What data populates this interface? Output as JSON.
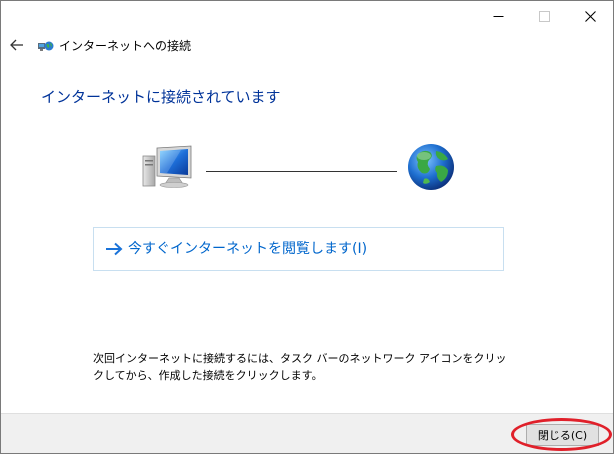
{
  "window": {
    "title": "インターネットへの接続",
    "controls": {
      "minimize": "minimize-icon",
      "maximize": "maximize-icon",
      "close": "close-icon"
    }
  },
  "main": {
    "heading": "インターネットに接続されています",
    "command_link": "今すぐインターネットを閲覧します(I)",
    "help_lines": [
      "次回インターネットに接続するには、タスク バーのネットワーク アイコンをクリッ",
      "クしてから、作成した接続をクリックします。"
    ]
  },
  "footer": {
    "close_label": "閉じる(C)"
  },
  "colors": {
    "heading": "#003399",
    "link": "#0066cc",
    "highlight": "#e0202a"
  }
}
